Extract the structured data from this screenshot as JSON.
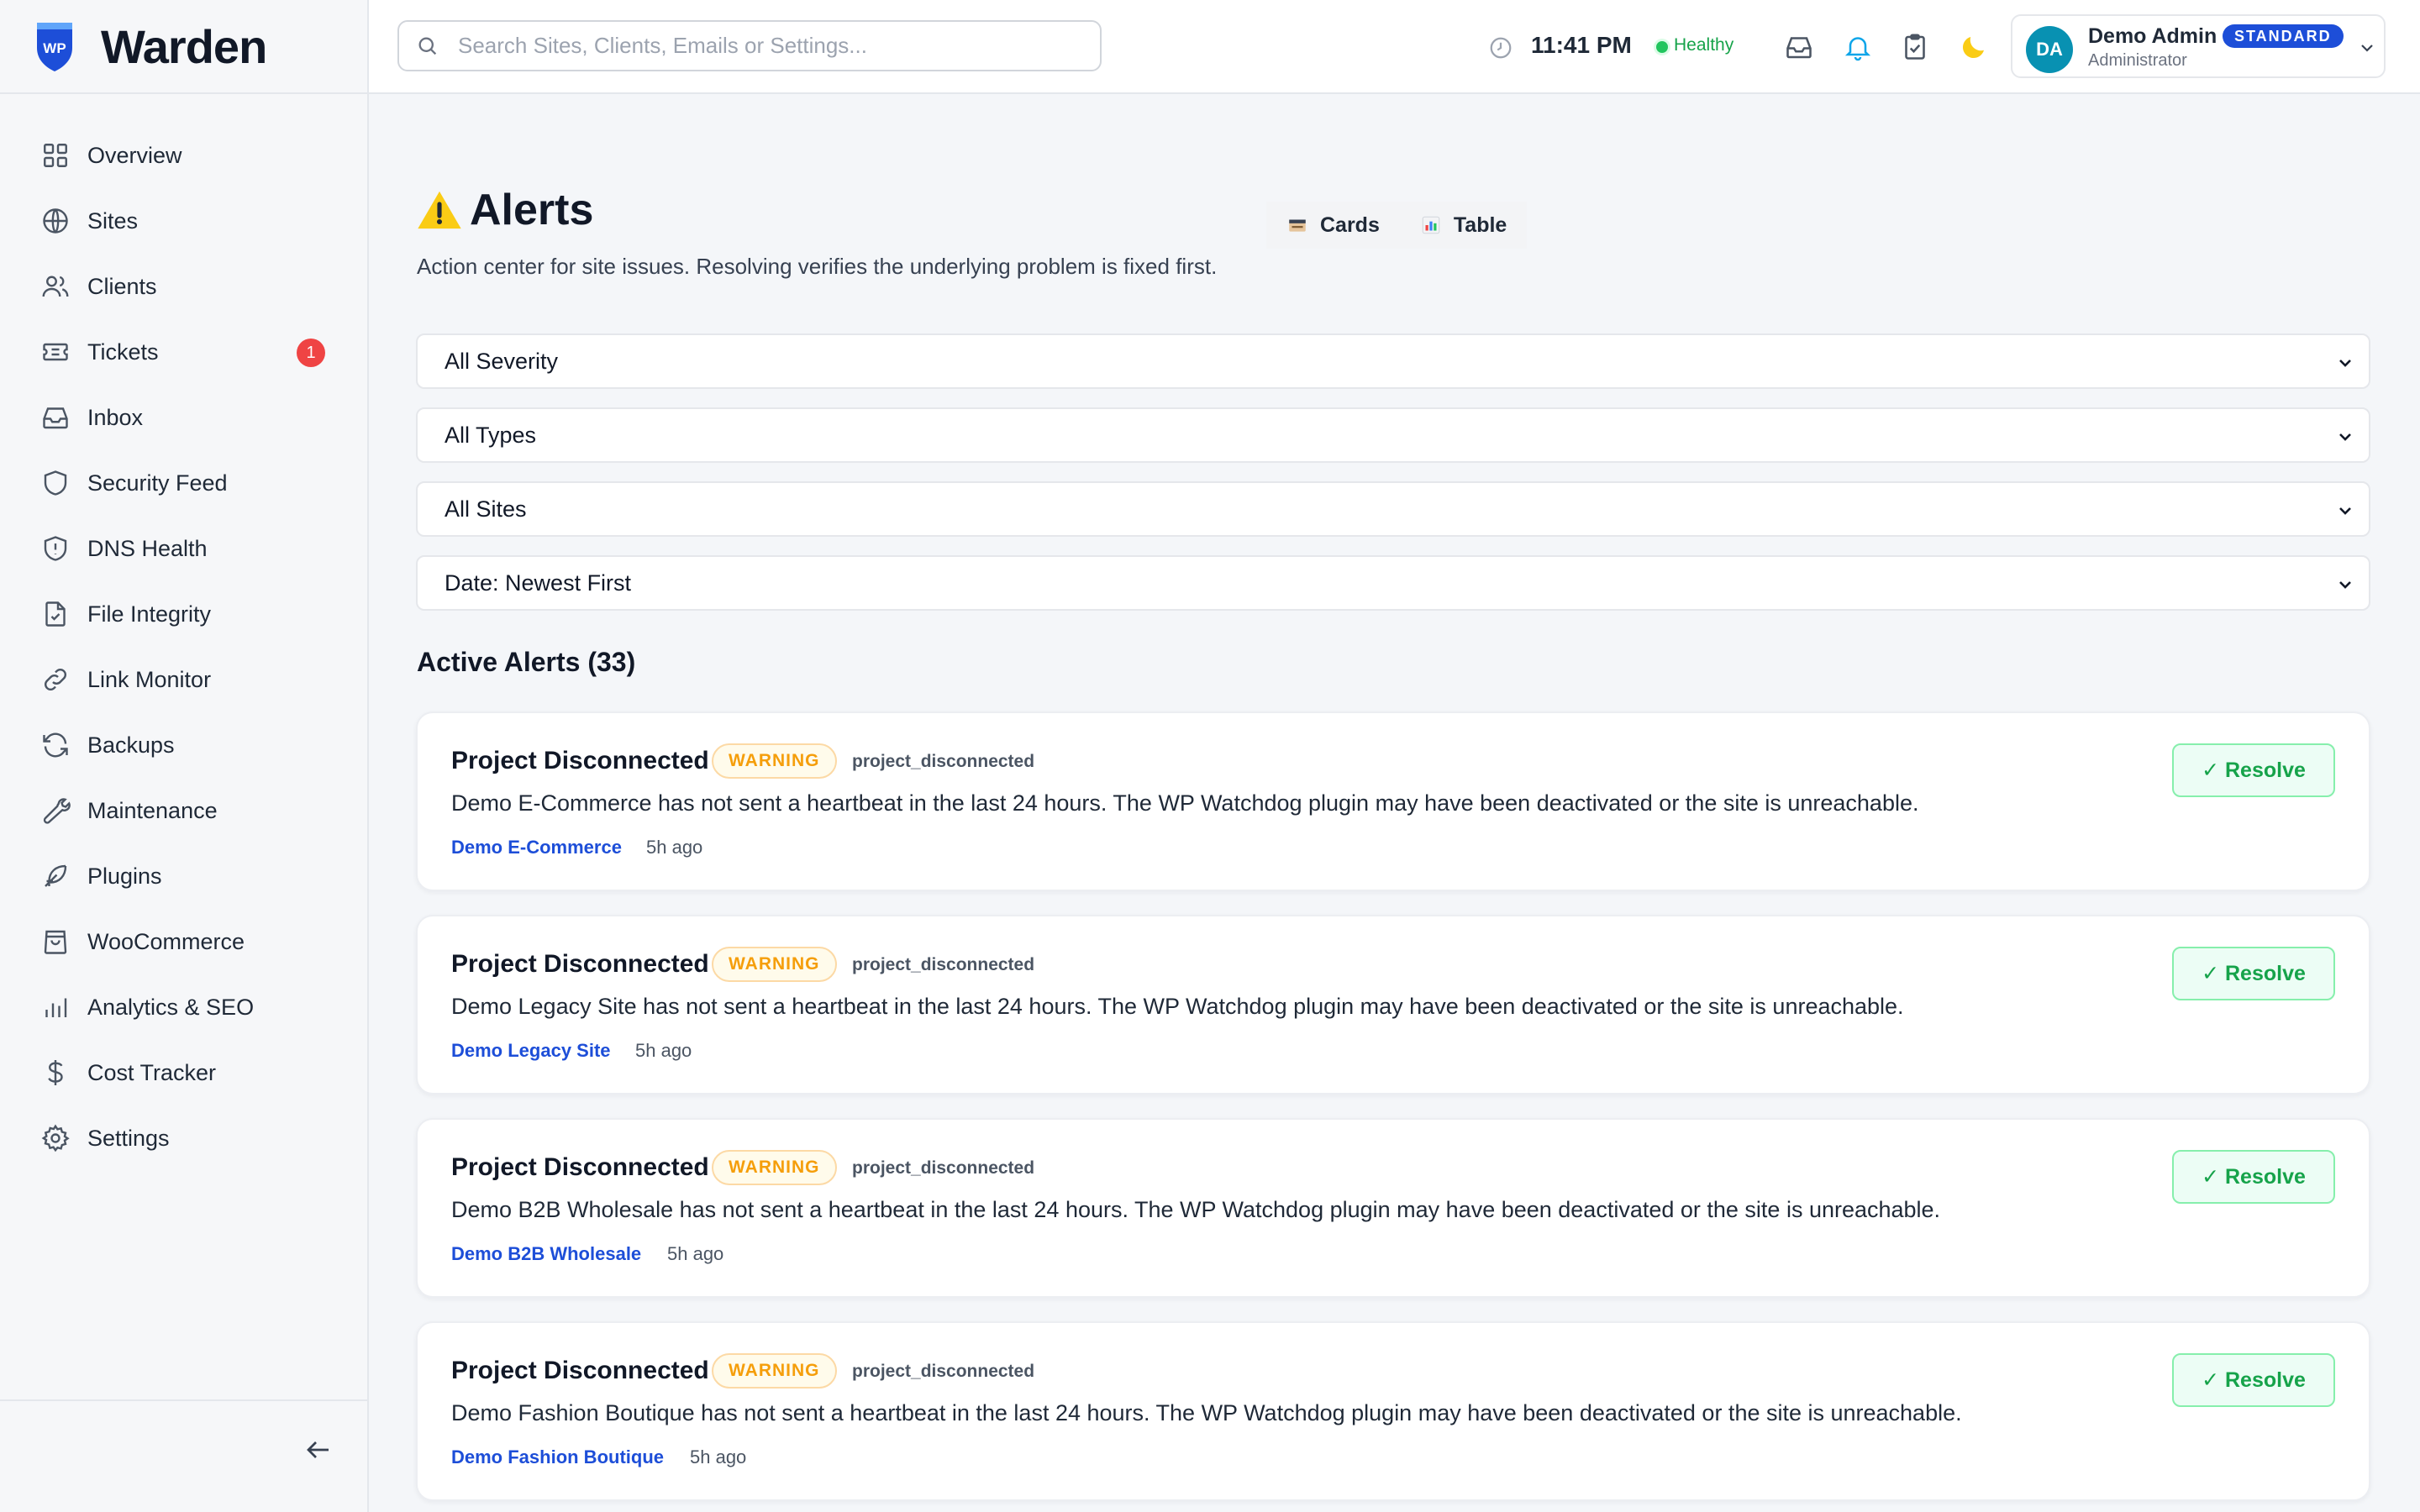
{
  "app": {
    "name": "Warden",
    "logo_text": "WP"
  },
  "sidebar": {
    "items": [
      {
        "label": "Overview",
        "icon": "grid-icon"
      },
      {
        "label": "Sites",
        "icon": "globe-icon"
      },
      {
        "label": "Clients",
        "icon": "users-icon"
      },
      {
        "label": "Tickets",
        "icon": "ticket-icon",
        "badge": "1"
      },
      {
        "label": "Inbox",
        "icon": "inbox-icon"
      },
      {
        "label": "Security Feed",
        "icon": "shield-icon"
      },
      {
        "label": "DNS Health",
        "icon": "shield-alert-icon"
      },
      {
        "label": "File Integrity",
        "icon": "file-check-icon"
      },
      {
        "label": "Link Monitor",
        "icon": "link-icon"
      },
      {
        "label": "Backups",
        "icon": "refresh-icon"
      },
      {
        "label": "Maintenance",
        "icon": "wrench-icon"
      },
      {
        "label": "Plugins",
        "icon": "feather-icon"
      },
      {
        "label": "WooCommerce",
        "icon": "shopping-bag-icon"
      },
      {
        "label": "Analytics & SEO",
        "icon": "bar-chart-icon"
      },
      {
        "label": "Cost Tracker",
        "icon": "dollar-icon"
      },
      {
        "label": "Settings",
        "icon": "gear-icon"
      }
    ]
  },
  "topbar": {
    "search_placeholder": "Search Sites, Clients, Emails or Settings...",
    "time": "11:41 PM",
    "health_status": "Healthy",
    "user": {
      "initials": "DA",
      "name": "Demo Admin",
      "role": "Administrator",
      "plan": "STANDARD"
    }
  },
  "page": {
    "title": "Alerts",
    "subtitle": "Action center for site issues. Resolving verifies the underlying problem is fixed first.",
    "view_toggle": [
      {
        "label": "Cards",
        "icon": "cards-icon"
      },
      {
        "label": "Table",
        "icon": "table-chart-icon"
      }
    ],
    "filters": {
      "severity": "All Severity",
      "types": "All Types",
      "sites": "All Sites",
      "sort": "Date: Newest First"
    },
    "section_title": "Active Alerts (33)"
  },
  "alerts": [
    {
      "title": "Project Disconnected",
      "severity": "WARNING",
      "type": "project_disconnected",
      "message": "Demo E-Commerce has not sent a heartbeat in the last 24 hours. The WP Watchdog plugin may have been deactivated or the site is unreachable.",
      "site": "Demo E-Commerce",
      "time": "5h ago",
      "action": "✓ Resolve"
    },
    {
      "title": "Project Disconnected",
      "severity": "WARNING",
      "type": "project_disconnected",
      "message": "Demo Legacy Site has not sent a heartbeat in the last 24 hours. The WP Watchdog plugin may have been deactivated or the site is unreachable.",
      "site": "Demo Legacy Site",
      "time": "5h ago",
      "action": "✓ Resolve"
    },
    {
      "title": "Project Disconnected",
      "severity": "WARNING",
      "type": "project_disconnected",
      "message": "Demo B2B Wholesale has not sent a heartbeat in the last 24 hours. The WP Watchdog plugin may have been deactivated or the site is unreachable.",
      "site": "Demo B2B Wholesale",
      "time": "5h ago",
      "action": "✓ Resolve"
    },
    {
      "title": "Project Disconnected",
      "severity": "WARNING",
      "type": "project_disconnected",
      "message": "Demo Fashion Boutique has not sent a heartbeat in the last 24 hours. The WP Watchdog plugin may have been deactivated or the site is unreachable.",
      "site": "Demo Fashion Boutique",
      "time": "5h ago",
      "action": "✓ Resolve"
    }
  ]
}
